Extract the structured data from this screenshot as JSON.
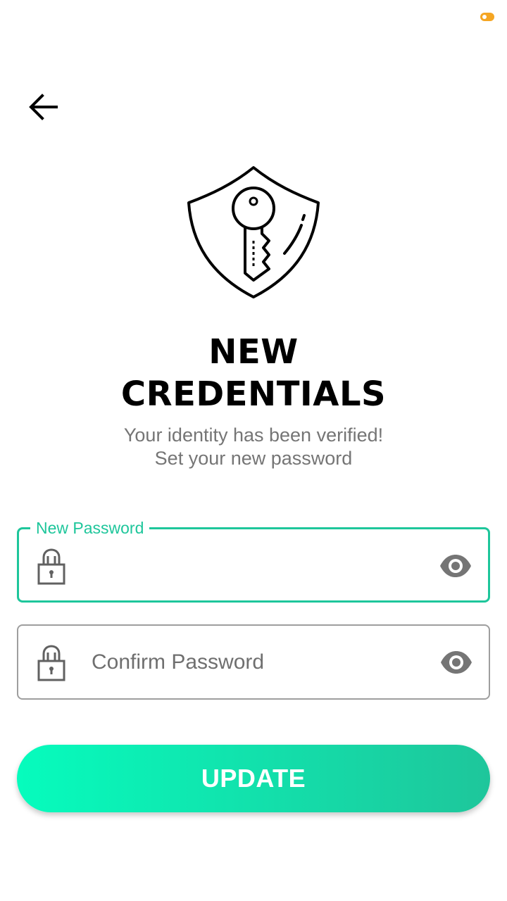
{
  "status_bar": {
    "badge_icon": "notification-badge-icon",
    "badge_color": "#f5a623"
  },
  "header": {
    "back_icon": "arrow-left-icon"
  },
  "hero": {
    "icon": "shield-key-icon"
  },
  "title": {
    "line1": "NEW",
    "line2": "CREDENTIALS"
  },
  "subtitle": {
    "line1": "Your identity has been verified!",
    "line2": "Set your new password"
  },
  "new_password": {
    "label": "New Password",
    "value": "",
    "lock_icon": "lock-icon",
    "toggle_icon": "eye-icon"
  },
  "confirm_password": {
    "placeholder": "Confirm Password",
    "value": "",
    "lock_icon": "lock-icon",
    "toggle_icon": "eye-icon"
  },
  "update_button": {
    "label": "UPDATE"
  },
  "colors": {
    "accent": "#1ec69b",
    "gradient_start": "#06fcbd",
    "gradient_end": "#1ec69b",
    "idle_border": "#9e9e9e",
    "subtitle_text": "#757575"
  }
}
